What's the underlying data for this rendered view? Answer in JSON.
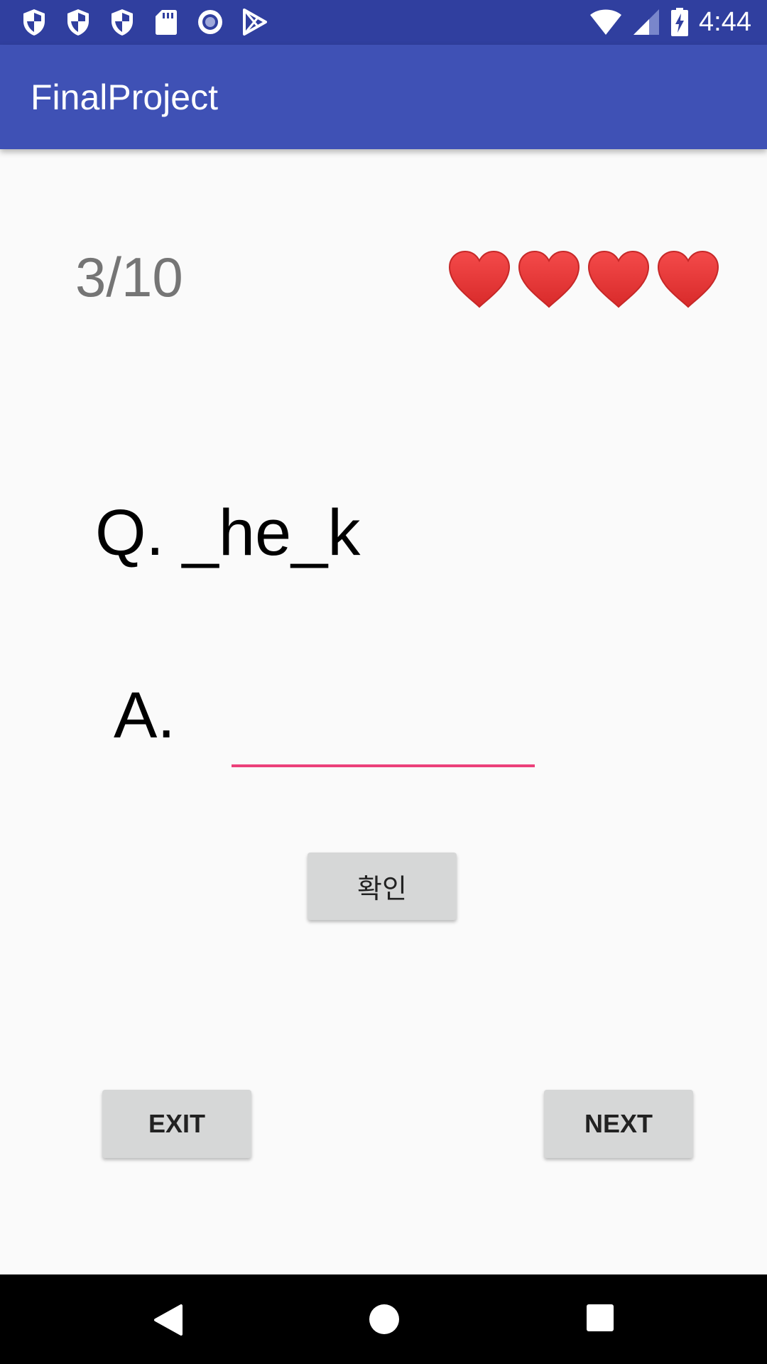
{
  "status_bar": {
    "time": "4:44",
    "left_icons": [
      "shield-icon",
      "shield-icon",
      "shield-icon",
      "sd-card-icon",
      "record-icon",
      "play-store-icon"
    ],
    "right_icons": [
      "wifi-icon",
      "signal-icon",
      "battery-charging-icon"
    ]
  },
  "app_bar": {
    "title": "FinalProject"
  },
  "quiz": {
    "progress": "3/10",
    "lives": 4,
    "question": "Q. _he_k",
    "answer_label": "A.",
    "answer_value": "",
    "confirm_label": "확인"
  },
  "actions": {
    "exit_label": "EXIT",
    "next_label": "NEXT"
  },
  "nav_bar": {
    "icons": [
      "back-icon",
      "home-icon",
      "recents-icon"
    ]
  },
  "colors": {
    "status_bar": "#303f9f",
    "app_bar": "#3f51b5",
    "accent": "#ec407a",
    "heart": "#e53935",
    "button": "#d6d7d7"
  }
}
